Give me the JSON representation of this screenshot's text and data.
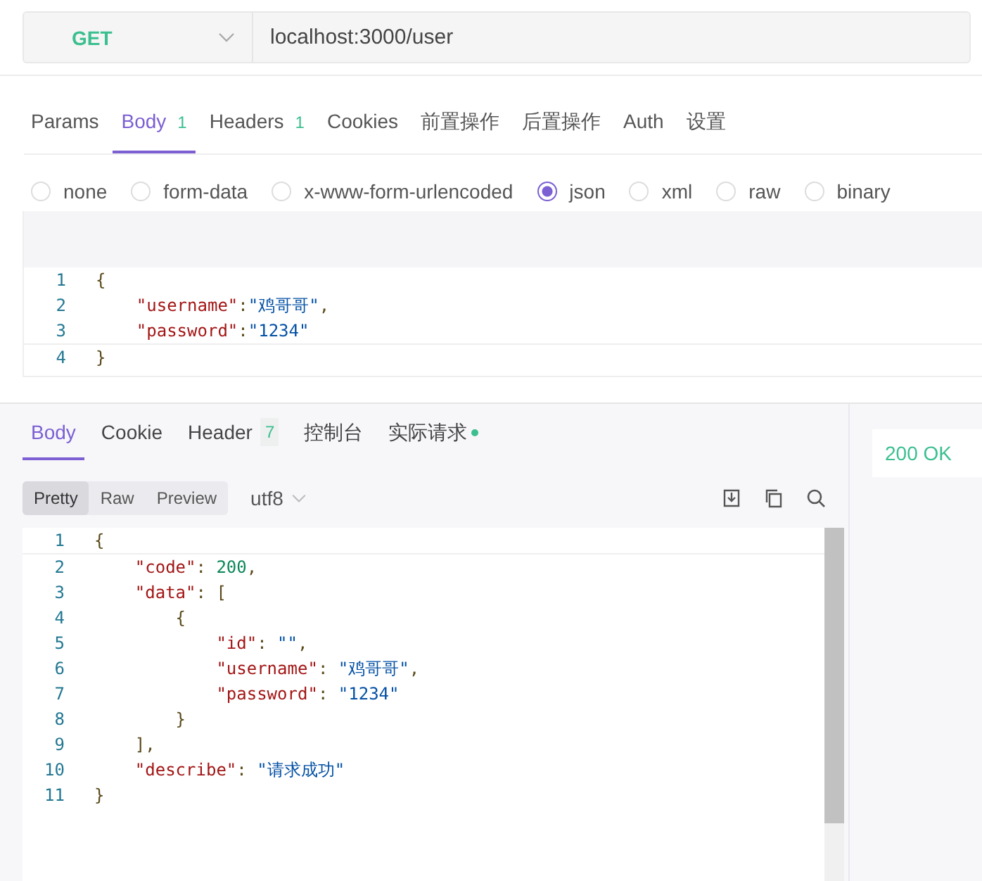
{
  "request": {
    "method": "GET",
    "url": "localhost:3000/user"
  },
  "request_tabs": [
    {
      "label": "Params",
      "selected": false
    },
    {
      "label": "Body",
      "count": "1",
      "selected": true
    },
    {
      "label": "Headers",
      "count": "1",
      "selected": false
    },
    {
      "label": "Cookies",
      "selected": false
    },
    {
      "label": "前置操作",
      "selected": false
    },
    {
      "label": "后置操作",
      "selected": false
    },
    {
      "label": "Auth",
      "selected": false
    },
    {
      "label": "设置",
      "selected": false
    }
  ],
  "body_types": [
    {
      "label": "none",
      "selected": false
    },
    {
      "label": "form-data",
      "selected": false
    },
    {
      "label": "x-www-form-urlencoded",
      "selected": false
    },
    {
      "label": "json",
      "selected": true
    },
    {
      "label": "xml",
      "selected": false
    },
    {
      "label": "raw",
      "selected": false
    },
    {
      "label": "binary",
      "selected": false
    }
  ],
  "request_body": [
    {
      "number": "1",
      "tokens": [
        {
          "text": "{",
          "kind": "punct"
        }
      ],
      "children": [
        {
          "number": "2",
          "tokens": [
            {
              "text": "\"username\"",
              "kind": "key"
            },
            {
              "text": ":",
              "kind": "punct"
            },
            {
              "text": "\"鸡哥哥\"",
              "kind": "string"
            },
            {
              "text": ",",
              "kind": "punct"
            }
          ]
        },
        {
          "number": "3",
          "tokens": [
            {
              "text": "\"password\"",
              "kind": "key"
            },
            {
              "text": ":",
              "kind": "punct"
            },
            {
              "text": "\"1234\"",
              "kind": "string"
            }
          ]
        }
      ]
    },
    {
      "number": "4",
      "tokens": [
        {
          "text": "}",
          "kind": "punct"
        }
      ]
    }
  ],
  "response_tabs": [
    {
      "label": "Body",
      "selected": true
    },
    {
      "label": "Cookie",
      "selected": false
    },
    {
      "label": "Header",
      "count": "7",
      "selected": false
    },
    {
      "label": "控制台",
      "selected": false
    },
    {
      "label": "实际请求",
      "dot": true,
      "selected": false
    }
  ],
  "view_modes": [
    {
      "label": "Pretty",
      "selected": true
    },
    {
      "label": "Raw",
      "selected": false
    },
    {
      "label": "Preview",
      "selected": false
    }
  ],
  "encoding": "utf8",
  "status": "200 OK",
  "response_body": [
    {
      "number": "1",
      "tokens": [
        {
          "text": "{",
          "kind": "punct"
        }
      ],
      "children": [
        {
          "number": "2",
          "tokens": [
            {
              "text": "\"code\"",
              "kind": "key"
            },
            {
              "text": ":",
              "kind": "punct"
            },
            {
              "text": "200",
              "kind": "number"
            },
            {
              "text": ",",
              "kind": "punct"
            }
          ]
        },
        {
          "number": "3",
          "tokens": [
            {
              "text": "\"data\"",
              "kind": "key"
            },
            {
              "text": ":",
              "kind": "punct"
            },
            {
              "text": "[",
              "kind": "punct"
            }
          ],
          "children": [
            {
              "number": "4",
              "tokens": [
                {
                  "text": "{",
                  "kind": "punct"
                }
              ],
              "children": [
                {
                  "number": "5",
                  "tokens": [
                    {
                      "text": "\"id\"",
                      "kind": "key"
                    },
                    {
                      "text": ":",
                      "kind": "punct"
                    },
                    {
                      "text": "\"\"",
                      "kind": "string"
                    },
                    {
                      "text": ",",
                      "kind": "punct"
                    }
                  ]
                },
                {
                  "number": "6",
                  "tokens": [
                    {
                      "text": "\"username\"",
                      "kind": "key"
                    },
                    {
                      "text": ":",
                      "kind": "punct"
                    },
                    {
                      "text": "\"鸡哥哥\"",
                      "kind": "string"
                    },
                    {
                      "text": ",",
                      "kind": "punct"
                    }
                  ]
                },
                {
                  "number": "7",
                  "tokens": [
                    {
                      "text": "\"password\"",
                      "kind": "key"
                    },
                    {
                      "text": ":",
                      "kind": "punct"
                    },
                    {
                      "text": "\"1234\"",
                      "kind": "string"
                    }
                  ]
                }
              ]
            },
            {
              "number": "8",
              "tokens": [
                {
                  "text": "}",
                  "kind": "punct"
                }
              ]
            }
          ]
        },
        {
          "number": "9",
          "tokens": [
            {
              "text": "],",
              "kind": "punct"
            }
          ]
        },
        {
          "number": "10",
          "tokens": [
            {
              "text": "\"describe\"",
              "kind": "key"
            },
            {
              "text": ":",
              "kind": "punct"
            },
            {
              "text": "\"请求成功\"",
              "kind": "string"
            }
          ]
        }
      ]
    },
    {
      "number": "11",
      "tokens": [
        {
          "text": "}",
          "kind": "punct"
        }
      ]
    }
  ]
}
